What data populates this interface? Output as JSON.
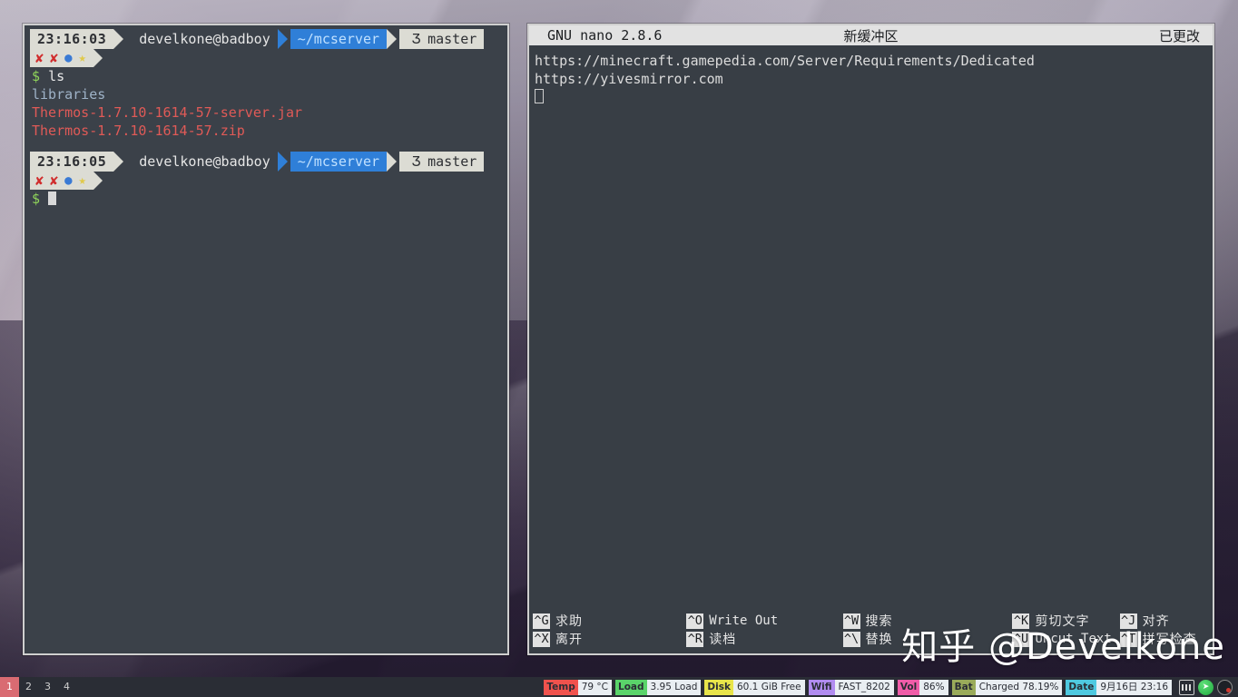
{
  "terminal": {
    "prompt1": {
      "time": "23:16:03",
      "user_host": "develkone@badboy",
      "path": "~/mcserver",
      "git_icon": "Ʒ",
      "git_branch": "master",
      "status_icons": [
        "✘",
        "✘",
        "●",
        "★"
      ]
    },
    "command": "ls",
    "dollar": "$",
    "output": [
      {
        "text": "libraries",
        "kind": "dir"
      },
      {
        "text": "Thermos-1.7.10-1614-57-server.jar",
        "kind": "archive"
      },
      {
        "text": "Thermos-1.7.10-1614-57.zip",
        "kind": "archive"
      }
    ],
    "prompt2": {
      "time": "23:16:05",
      "user_host": "develkone@badboy",
      "path": "~/mcserver",
      "git_icon": "Ʒ",
      "git_branch": "master",
      "status_icons": [
        "✘",
        "✘",
        "●",
        "★"
      ]
    },
    "colors": {
      "background": "#3b4149",
      "path_segment": "#2f7fd8",
      "light_segment": "#dcdcd4",
      "prompt_green": "#8fd45a",
      "dir_blue": "#9fb3c8",
      "archive_red": "#e05a57"
    }
  },
  "nano": {
    "title_left": "GNU nano 2.8.6",
    "title_center": "新缓冲区",
    "title_right": "已更改",
    "lines": [
      "https://minecraft.gamepedia.com/Server/Requirements/Dedicated",
      "https://yivesmirror.com"
    ],
    "shortcuts_row1": [
      {
        "key": "^G",
        "label": "求助",
        "mono": false
      },
      {
        "key": "^O",
        "label": "Write Out",
        "mono": true
      },
      {
        "key": "^W",
        "label": "搜索",
        "mono": false
      },
      {
        "key": "^K",
        "label": "剪切文字",
        "mono": false
      },
      {
        "key": "^J",
        "label": "对齐",
        "mono": false
      }
    ],
    "shortcuts_row2": [
      {
        "key": "^X",
        "label": "离开",
        "mono": false
      },
      {
        "key": "^R",
        "label": "读档",
        "mono": false
      },
      {
        "key": "^\\",
        "label": "替换",
        "mono": false
      },
      {
        "key": "^U",
        "label": "Uncut Text",
        "mono": true
      },
      {
        "key": "^T",
        "label": "拼写检查",
        "mono": false
      }
    ]
  },
  "watermark": "知乎 @Develkone",
  "taskbar": {
    "workspaces": [
      {
        "label": "1",
        "active": true
      },
      {
        "label": "2",
        "active": false
      },
      {
        "label": "3",
        "active": false
      },
      {
        "label": "4",
        "active": false
      }
    ],
    "tray": [
      {
        "name": "temp",
        "label": "Temp",
        "value": "79 °C",
        "color": "#f0524d"
      },
      {
        "name": "load",
        "label": "Load",
        "value": "3.95 Load",
        "color": "#5ad46a"
      },
      {
        "name": "disk",
        "label": "Disk",
        "value": "60.1 GiB Free",
        "color": "#e8e44a"
      },
      {
        "name": "wifi",
        "label": "Wifi",
        "value": "FAST_8202",
        "color": "#b18cf0"
      },
      {
        "name": "vol",
        "label": "Vol",
        "value": "86%",
        "color": "#f05ca8"
      },
      {
        "name": "bat",
        "label": "Bat",
        "value": "Charged 78.19%",
        "color": "#9aab5a"
      },
      {
        "name": "date",
        "label": "Date",
        "value": "9月16日 23:16",
        "color": "#4ec9e0"
      }
    ],
    "icons": [
      "keyboard-input-icon",
      "telegram-icon",
      "obs-icon"
    ]
  }
}
